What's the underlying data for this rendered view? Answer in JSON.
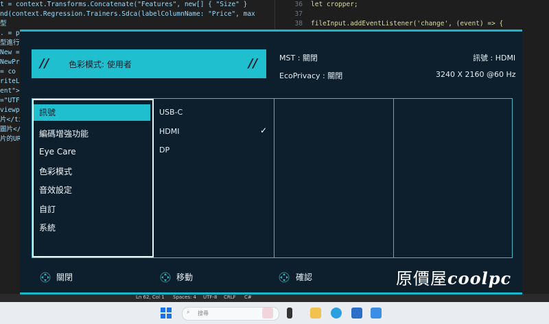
{
  "code_left": [
    "t = context.Transforms.Concatenate(\"Features\", new[] { \"Size\" }",
    "nd(context.Regression.Trainers.Sdca(labelColumnName: \"Price\", max",
    "型",
    ". = pi",
    "",
    "型進行",
    "New =",
    "NewPre",
    "= co",
    "",
    "riteL",
    "",
    "",
    "ent\">",
    "",
    "=\"UTF",
    "viewpo",
    "片</ti",
    "",
    "",
    "圖片</h",
    "片的URL"
  ],
  "code_right": [
    {
      "ln": "36",
      "src": "let cropper;"
    },
    {
      "ln": "37",
      "src": ""
    },
    {
      "ln": "38",
      "src": "fileInput.addEventListener('change', (event) => {"
    },
    {
      "ln": "39",
      "src": "  const file = event.target.files[0];"
    }
  ],
  "vs_status": {
    "pos": "Ln 62, Col 1",
    "spaces": "Spaces: 4",
    "enc": "UTF-8",
    "eol": "CRLF",
    "lang": "C#"
  },
  "taskbar": {
    "search_placeholder": "搜尋"
  },
  "osd": {
    "color_mode_title": "色彩模式: 使用者",
    "slash": "//",
    "mst": "MST : 關閉",
    "eco": "EcoPrivacy : 關閉",
    "signal": "訊號 : HDMI",
    "resolution": "3240 X 2160 @60 Hz",
    "menu": [
      "訊號",
      "編碼增強功能",
      "Eye Care",
      "色彩模式",
      "音效設定",
      "自訂",
      "系統"
    ],
    "submenu": [
      "USB-C",
      "HDMI",
      "DP"
    ],
    "check": "✓",
    "footer": {
      "close": "關閉",
      "move": "移動",
      "confirm": "確認"
    },
    "brand": {
      "prefix": "原價屋",
      "suffix": "coolpc"
    }
  },
  "colors": {
    "accent": "#1fbfd0",
    "panel_bg": "#0d1f2c"
  }
}
